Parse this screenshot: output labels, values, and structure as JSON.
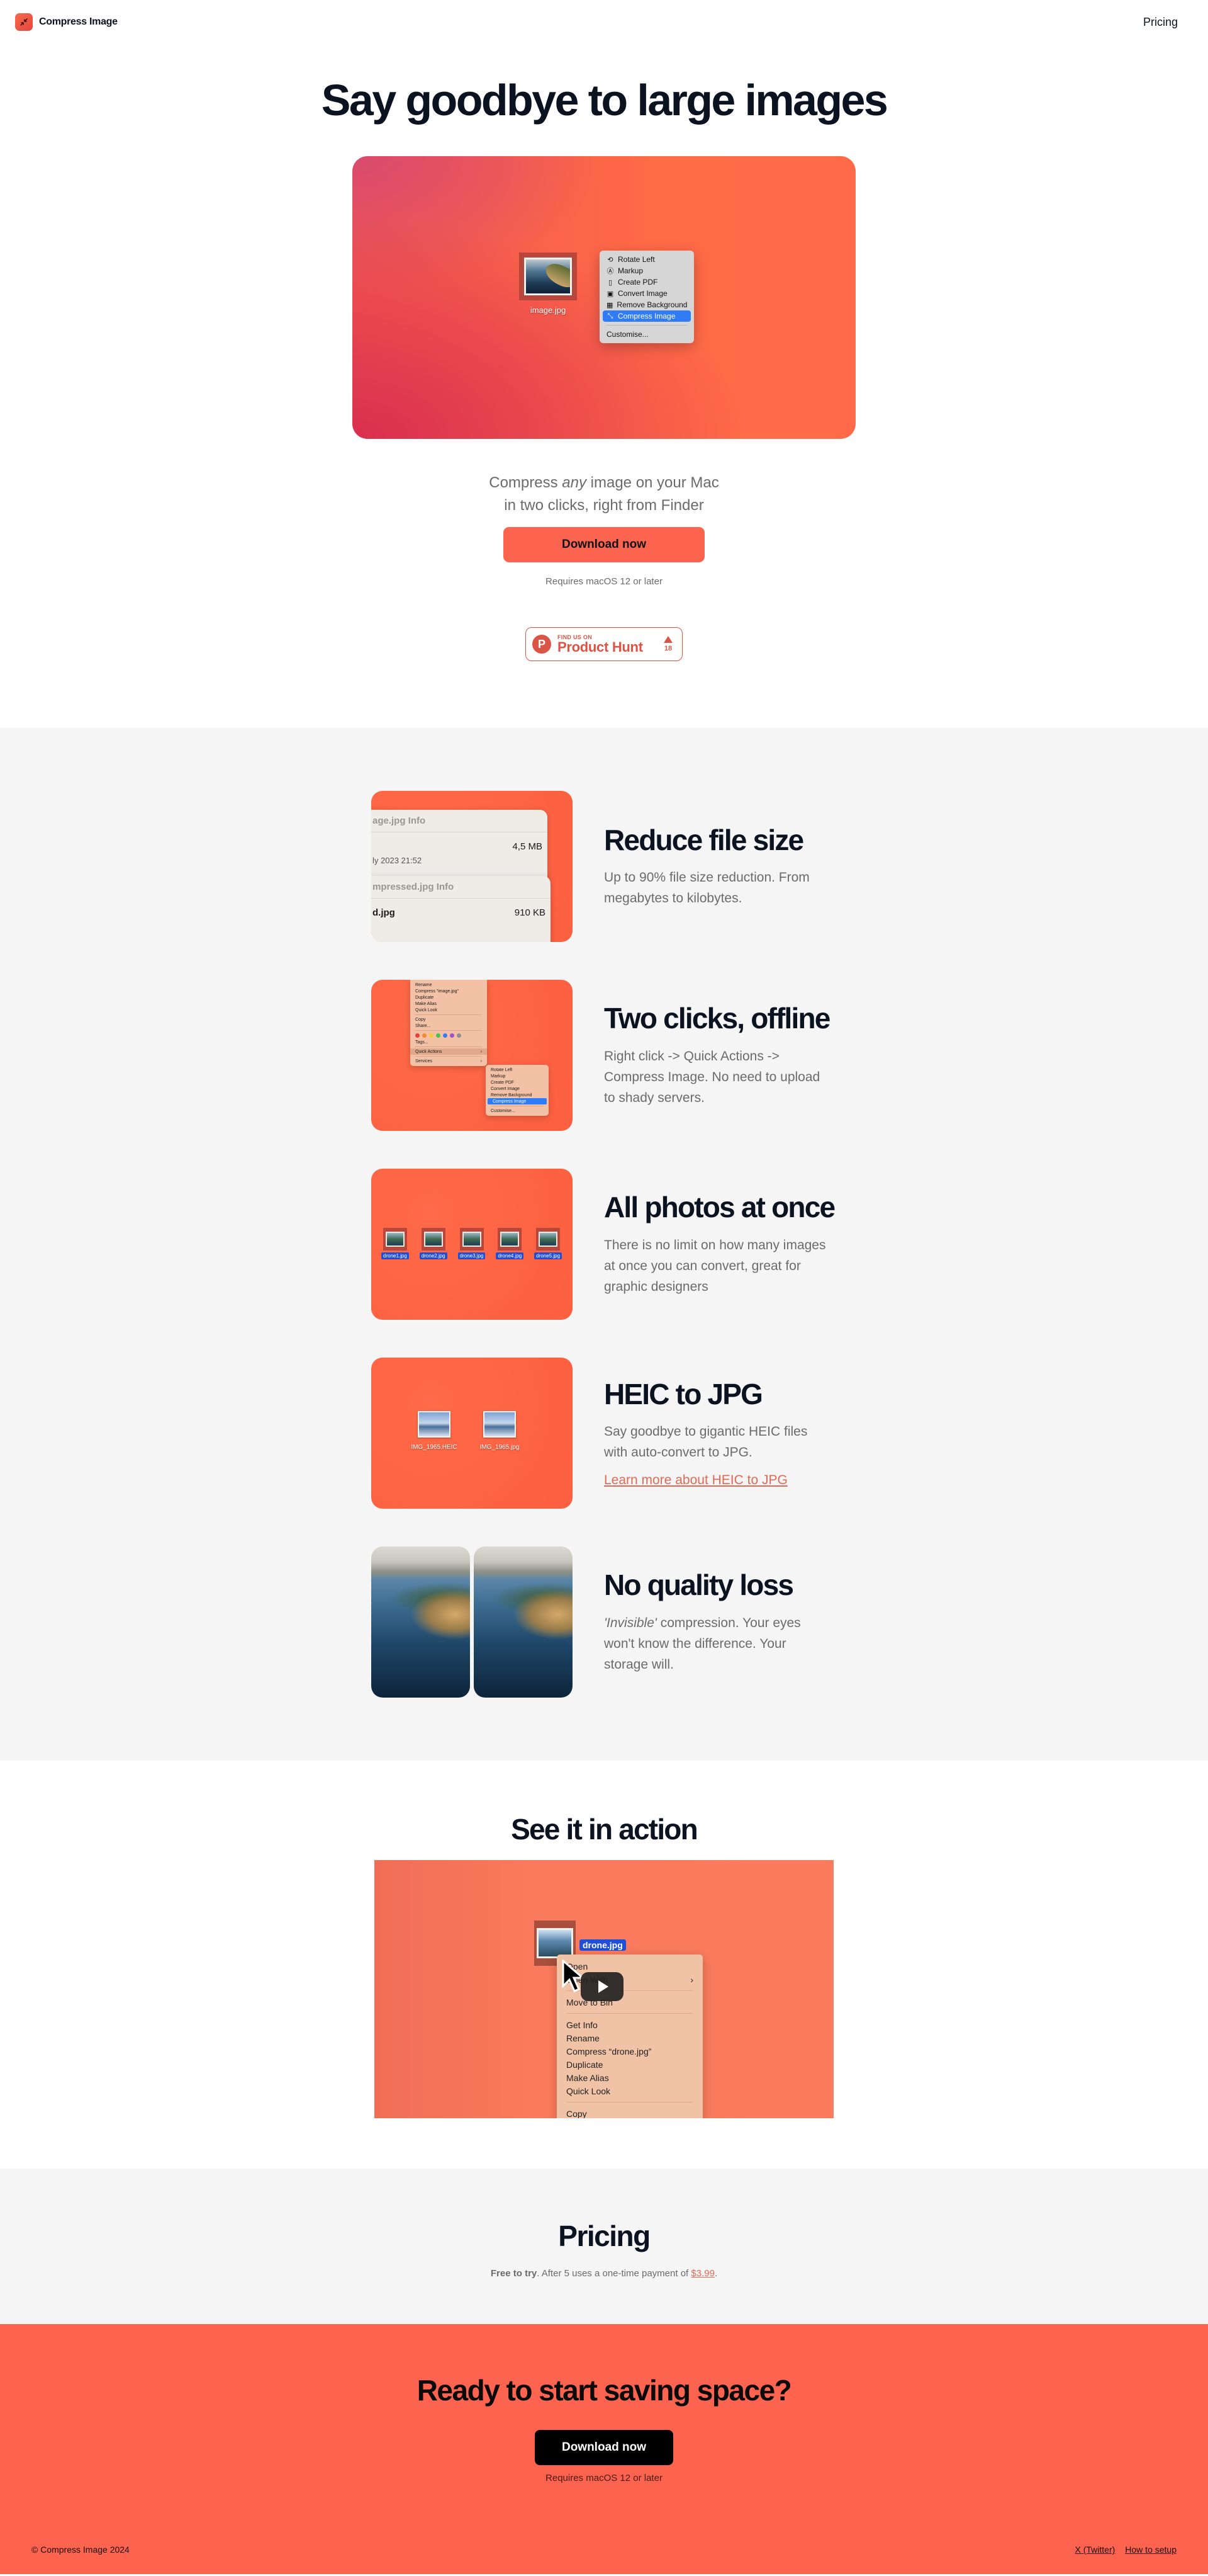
{
  "header": {
    "brand_name": "Compress Image",
    "brand_icon": "compress-arrows-icon",
    "nav_pricing": "Pricing"
  },
  "hero": {
    "title": "Say goodbye to large images",
    "visual": {
      "file_name": "image.jpg",
      "menu_items": [
        {
          "icon": "rotate-left-icon",
          "glyph": "⟲",
          "label": "Rotate Left"
        },
        {
          "icon": "markup-icon",
          "glyph": "Ⓐ",
          "label": "Markup"
        },
        {
          "icon": "document-icon",
          "glyph": "▯",
          "label": "Create PDF"
        },
        {
          "icon": "convert-image-icon",
          "glyph": "▣",
          "label": "Convert Image"
        },
        {
          "icon": "remove-background-icon",
          "glyph": "▦",
          "label": "Remove Background"
        },
        {
          "icon": "compress-arrows-icon",
          "glyph": "⤡",
          "label": "Compress Image",
          "active": true
        }
      ],
      "menu_footer": "Customise..."
    },
    "subtitle_pre": "Compress ",
    "subtitle_em": "any",
    "subtitle_post": " image on your Mac",
    "subtitle_line2": "in two clicks, right from Finder",
    "download_label": "Download now",
    "requirement": "Requires macOS 12 or later",
    "product_hunt": {
      "small": "FIND US ON",
      "big": "Product Hunt",
      "logo_letter": "P",
      "votes": "18"
    }
  },
  "features": [
    {
      "title": "Reduce file size",
      "body": "Up to 90% file size reduction. From megabytes to kilobytes.",
      "visual": {
        "pane1_title": "age.jpg Info",
        "pane1_size": "4,5 MB",
        "pane1_date": "ly 2023 21:52",
        "pane2_title": "mpressed.jpg Info",
        "pane2_name": "d.jpg",
        "pane2_size": "910 KB"
      }
    },
    {
      "title": "Two clicks, offline",
      "body": "Right click -> Quick Actions -> Compress Image. No need to upload to shady servers.",
      "visual": {
        "menu_top": [
          "Rename",
          "Compress “image.jpg”",
          "Duplicate",
          "Make Alias",
          "Quick Look"
        ],
        "menu_mid": [
          "Copy",
          "Share..."
        ],
        "tag_colors": [
          "#e8413c",
          "#f28a30",
          "#f3cc30",
          "#4cc24a",
          "#2f7cf6",
          "#a04fd0",
          "#8e8e8e"
        ],
        "tags_label": "Tags...",
        "quick_actions": "Quick Actions",
        "services": "Services",
        "submenu": [
          "Rotate Left",
          "Markup",
          "Create PDF",
          "Convert Image",
          "Remove Background",
          "Compress Image"
        ],
        "submenu_footer": "Customise..."
      }
    },
    {
      "title": "All photos at once",
      "body": "There is no limit on how many images at once you can convert, great for graphic designers",
      "visual": {
        "files": [
          "drone1.jpg",
          "drone2.jpg",
          "drone3.jpg",
          "drone4.jpg",
          "drone5.jpg"
        ]
      }
    },
    {
      "title": "HEIC to JPG",
      "body": "Say goodbye to gigantic HEIC files with auto-convert to JPG.",
      "link": "Learn more about HEIC to JPG",
      "visual": {
        "files": [
          "IMG_1965.HEIC",
          "IMG_1965.jpg"
        ]
      }
    },
    {
      "title": "No quality loss",
      "body_em": "'Invisible'",
      "body": " compression. Your eyes won't know the difference. Your storage will."
    }
  ],
  "action": {
    "title": "See it in action",
    "video": {
      "file_name": "drone.jpg",
      "menu": [
        "Open",
        "Open With",
        "Move to Bin",
        "Get Info",
        "Rename",
        "Compress “drone.jpg”",
        "Duplicate",
        "Make Alias",
        "Quick Look",
        "Copy"
      ]
    }
  },
  "pricing": {
    "title": "Pricing",
    "free_label": "Free to try",
    "text": ". After 5 uses a one-time payment of ",
    "price": "$3.99",
    "end": "."
  },
  "cta": {
    "title": "Ready to start saving space?",
    "download_label": "Download now",
    "requirement": "Requires macOS 12 or later"
  },
  "footer": {
    "copyright": "© Compress Image 2024",
    "links": [
      "X (Twitter)",
      "How to setup"
    ]
  },
  "colors": {
    "accent": "#fc6450",
    "link": "#e06a55",
    "product_hunt": "#da5545",
    "heading": "#0b1320",
    "body_text": "#6b6b6b",
    "section_gray": "#f5f5f5"
  }
}
